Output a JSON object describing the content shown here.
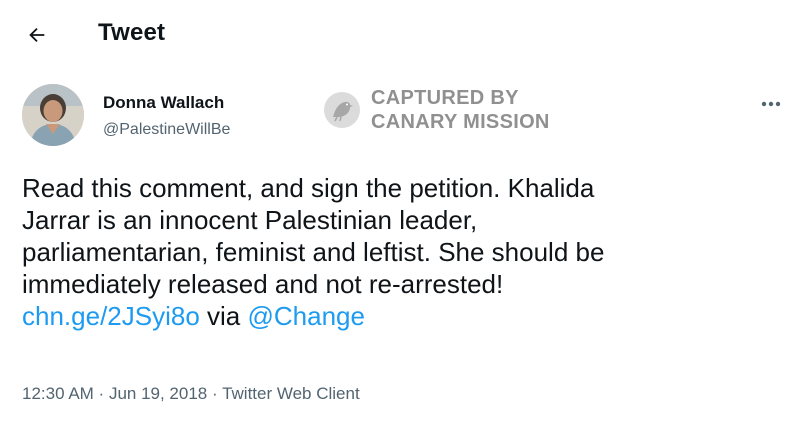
{
  "header": {
    "title": "Tweet",
    "back_icon": "arrow-left-icon"
  },
  "author": {
    "name": "Donna Wallach",
    "handle": "@PalestineWillBe",
    "avatar_icon": "user-avatar"
  },
  "watermark": {
    "line1": "CAPTURED BY",
    "line2": "CANARY MISSION",
    "icon": "canary-bird-icon"
  },
  "menu": {
    "more_icon": "more-horizontal-icon"
  },
  "tweet": {
    "lines": [
      "Read this comment, and sign the petition. Khalida",
      "Jarrar is an innocent Palestinian leader,",
      "parliamentarian, feminist and leftist. She should be",
      "immediately released and not re-arrested!"
    ],
    "link_text": "chn.ge/2JSyi8o",
    "via_text": " via ",
    "mention": "@Change"
  },
  "meta": {
    "time": "12:30 AM",
    "separator": " · ",
    "date": "Jun 19, 2018",
    "client": "Twitter Web Client"
  },
  "colors": {
    "text": "#0f1419",
    "secondary": "#536471",
    "link": "#1d9bf0",
    "watermark": "#6b6b6b"
  }
}
